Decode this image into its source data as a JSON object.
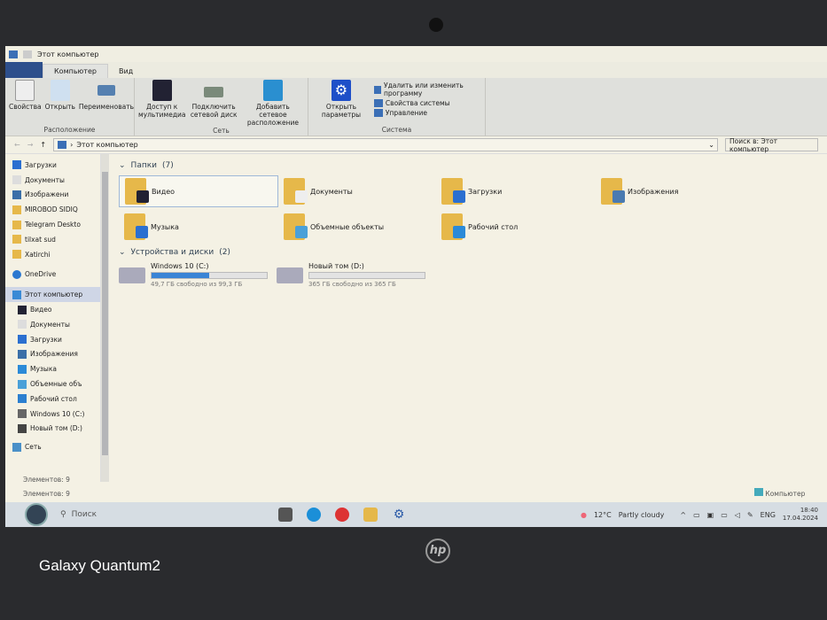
{
  "window": {
    "title": "Этот компьютер"
  },
  "tabs": [
    "Компьютер",
    "Вид"
  ],
  "ribbon": {
    "location": {
      "label": "Расположение",
      "buttons": [
        "Свойства",
        "Открыть",
        "Переименовать"
      ]
    },
    "network": {
      "label": "Сеть",
      "buttons": [
        "Доступ к мультимедиа",
        "Подключить сетевой диск",
        "Добавить сетевое расположение"
      ]
    },
    "system": {
      "label": "Система",
      "open_settings": "Открыть параметры",
      "items": [
        "Удалить или изменить программу",
        "Свойства системы",
        "Управление"
      ]
    }
  },
  "address": {
    "path": "Этот компьютер",
    "search_placeholder": "Поиск в: Этот компьютер"
  },
  "nav": {
    "quick": [
      "Загрузки",
      "Документы",
      "Изображени",
      "MIROBOD SIDIQ",
      "Telegram Deskto",
      "tilxat sud",
      "Xatirchi"
    ],
    "onedrive": "OneDrive",
    "pc": "Этот компьютер",
    "pc_items": [
      "Видео",
      "Документы",
      "Загрузки",
      "Изображения",
      "Музыка",
      "Объемные объ",
      "Рабочий стол",
      "Windows 10 (C:)",
      "Новый том (D:)"
    ],
    "network": "Сеть"
  },
  "folders": {
    "header": "Папки",
    "count": "(7)",
    "items": [
      "Видео",
      "Документы",
      "Загрузки",
      "Изображения",
      "Музыка",
      "Объемные объекты",
      "Рабочий стол"
    ]
  },
  "drives": {
    "header": "Устройства и диски",
    "count": "(2)",
    "items": [
      {
        "name": "Windows 10 (C:)",
        "free": "49,7 ГБ свободно из 99,3 ГБ",
        "used_percent": 50
      },
      {
        "name": "Новый том (D:)",
        "free": "365 ГБ свободно из 365 ГБ",
        "used_percent": 0
      }
    ]
  },
  "status": {
    "items1": "Элементов: 9",
    "items2": "Элементов: 9",
    "computer": "Компьютер"
  },
  "taskbar": {
    "search": "Поиск",
    "weather": "12°C",
    "weather_text": "Partly cloudy",
    "lang": "ENG",
    "time": "18:40",
    "date": "17.04.2024"
  },
  "overlay": {
    "watermark": "Galaxy Quantum2",
    "logo": "hp"
  }
}
